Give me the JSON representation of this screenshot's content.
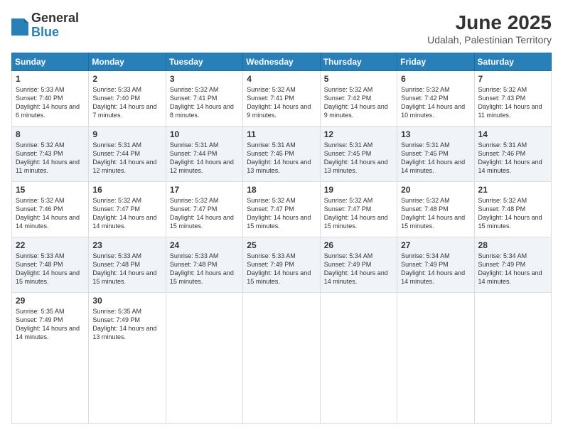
{
  "header": {
    "logo_general": "General",
    "logo_blue": "Blue",
    "month": "June 2025",
    "location": "Udalah, Palestinian Territory"
  },
  "weekdays": [
    "Sunday",
    "Monday",
    "Tuesday",
    "Wednesday",
    "Thursday",
    "Friday",
    "Saturday"
  ],
  "weeks": [
    [
      {
        "day": "1",
        "sunrise": "5:33 AM",
        "sunset": "7:40 PM",
        "daylight": "14 hours and 6 minutes."
      },
      {
        "day": "2",
        "sunrise": "5:33 AM",
        "sunset": "7:40 PM",
        "daylight": "14 hours and 7 minutes."
      },
      {
        "day": "3",
        "sunrise": "5:32 AM",
        "sunset": "7:41 PM",
        "daylight": "14 hours and 8 minutes."
      },
      {
        "day": "4",
        "sunrise": "5:32 AM",
        "sunset": "7:41 PM",
        "daylight": "14 hours and 9 minutes."
      },
      {
        "day": "5",
        "sunrise": "5:32 AM",
        "sunset": "7:42 PM",
        "daylight": "14 hours and 9 minutes."
      },
      {
        "day": "6",
        "sunrise": "5:32 AM",
        "sunset": "7:42 PM",
        "daylight": "14 hours and 10 minutes."
      },
      {
        "day": "7",
        "sunrise": "5:32 AM",
        "sunset": "7:43 PM",
        "daylight": "14 hours and 11 minutes."
      }
    ],
    [
      {
        "day": "8",
        "sunrise": "5:32 AM",
        "sunset": "7:43 PM",
        "daylight": "14 hours and 11 minutes."
      },
      {
        "day": "9",
        "sunrise": "5:31 AM",
        "sunset": "7:44 PM",
        "daylight": "14 hours and 12 minutes."
      },
      {
        "day": "10",
        "sunrise": "5:31 AM",
        "sunset": "7:44 PM",
        "daylight": "14 hours and 12 minutes."
      },
      {
        "day": "11",
        "sunrise": "5:31 AM",
        "sunset": "7:45 PM",
        "daylight": "14 hours and 13 minutes."
      },
      {
        "day": "12",
        "sunrise": "5:31 AM",
        "sunset": "7:45 PM",
        "daylight": "14 hours and 13 minutes."
      },
      {
        "day": "13",
        "sunrise": "5:31 AM",
        "sunset": "7:45 PM",
        "daylight": "14 hours and 14 minutes."
      },
      {
        "day": "14",
        "sunrise": "5:31 AM",
        "sunset": "7:46 PM",
        "daylight": "14 hours and 14 minutes."
      }
    ],
    [
      {
        "day": "15",
        "sunrise": "5:32 AM",
        "sunset": "7:46 PM",
        "daylight": "14 hours and 14 minutes."
      },
      {
        "day": "16",
        "sunrise": "5:32 AM",
        "sunset": "7:47 PM",
        "daylight": "14 hours and 14 minutes."
      },
      {
        "day": "17",
        "sunrise": "5:32 AM",
        "sunset": "7:47 PM",
        "daylight": "14 hours and 15 minutes."
      },
      {
        "day": "18",
        "sunrise": "5:32 AM",
        "sunset": "7:47 PM",
        "daylight": "14 hours and 15 minutes."
      },
      {
        "day": "19",
        "sunrise": "5:32 AM",
        "sunset": "7:47 PM",
        "daylight": "14 hours and 15 minutes."
      },
      {
        "day": "20",
        "sunrise": "5:32 AM",
        "sunset": "7:48 PM",
        "daylight": "14 hours and 15 minutes."
      },
      {
        "day": "21",
        "sunrise": "5:32 AM",
        "sunset": "7:48 PM",
        "daylight": "14 hours and 15 minutes."
      }
    ],
    [
      {
        "day": "22",
        "sunrise": "5:33 AM",
        "sunset": "7:48 PM",
        "daylight": "14 hours and 15 minutes."
      },
      {
        "day": "23",
        "sunrise": "5:33 AM",
        "sunset": "7:48 PM",
        "daylight": "14 hours and 15 minutes."
      },
      {
        "day": "24",
        "sunrise": "5:33 AM",
        "sunset": "7:48 PM",
        "daylight": "14 hours and 15 minutes."
      },
      {
        "day": "25",
        "sunrise": "5:33 AM",
        "sunset": "7:49 PM",
        "daylight": "14 hours and 15 minutes."
      },
      {
        "day": "26",
        "sunrise": "5:34 AM",
        "sunset": "7:49 PM",
        "daylight": "14 hours and 14 minutes."
      },
      {
        "day": "27",
        "sunrise": "5:34 AM",
        "sunset": "7:49 PM",
        "daylight": "14 hours and 14 minutes."
      },
      {
        "day": "28",
        "sunrise": "5:34 AM",
        "sunset": "7:49 PM",
        "daylight": "14 hours and 14 minutes."
      }
    ],
    [
      {
        "day": "29",
        "sunrise": "5:35 AM",
        "sunset": "7:49 PM",
        "daylight": "14 hours and 14 minutes."
      },
      {
        "day": "30",
        "sunrise": "5:35 AM",
        "sunset": "7:49 PM",
        "daylight": "14 hours and 13 minutes."
      },
      null,
      null,
      null,
      null,
      null
    ]
  ]
}
